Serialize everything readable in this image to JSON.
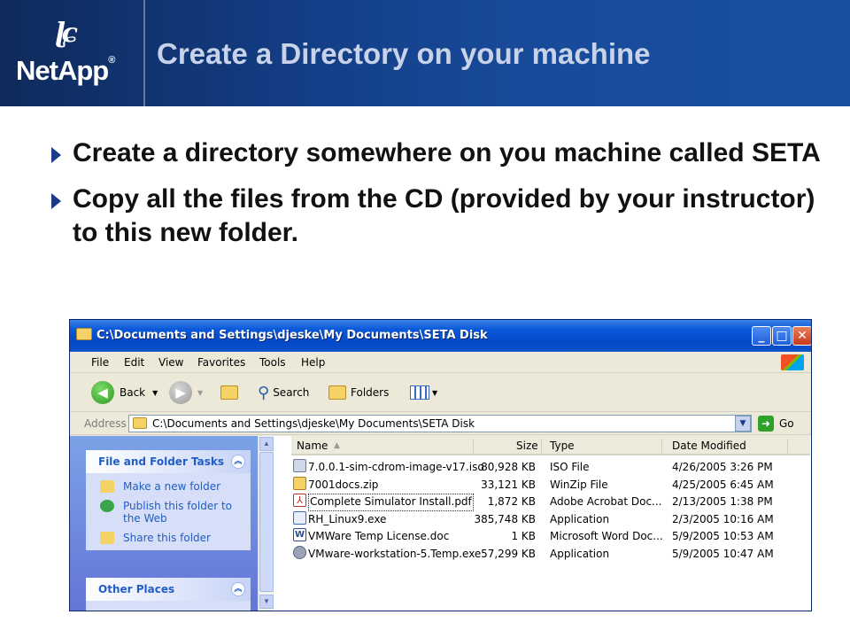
{
  "header": {
    "title": "Create a Directory on your machine",
    "logo_text": "NetApp",
    "logo_reg": "®"
  },
  "bullets": [
    "Create a directory somewhere on you machine called SETA",
    "Copy all the files from the CD (provided by your instructor) to this new folder."
  ],
  "window": {
    "title": "C:\\Documents and Settings\\djeske\\My Documents\\SETA Disk",
    "menu": [
      "File",
      "Edit",
      "View",
      "Favorites",
      "Tools",
      "Help"
    ],
    "toolbar": {
      "back": "Back",
      "search": "Search",
      "folders": "Folders"
    },
    "address": {
      "label": "Address",
      "value": "C:\\Documents and Settings\\djeske\\My Documents\\SETA Disk",
      "go": "Go"
    },
    "tasks": {
      "file_folder_title": "File and Folder Tasks",
      "items": [
        "Make a new folder",
        "Publish this folder to the Web",
        "Share this folder"
      ],
      "other_places_title": "Other Places"
    },
    "columns": {
      "name": "Name",
      "size": "Size",
      "type": "Type",
      "date": "Date Modified"
    },
    "files": [
      {
        "name": "7.0.0.1-sim-cdrom-image-v17.iso",
        "size": "80,928 KB",
        "type": "ISO File",
        "date": "4/26/2005 3:26 PM",
        "icon": "iso-icon"
      },
      {
        "name": "7001docs.zip",
        "size": "33,121 KB",
        "type": "WinZip File",
        "date": "4/25/2005 6:45 AM",
        "icon": "zip-icon"
      },
      {
        "name": "Complete Simulator Install.pdf",
        "size": "1,872 KB",
        "type": "Adobe Acrobat Doc...",
        "date": "2/13/2005 1:38 PM",
        "icon": "pdf-icon"
      },
      {
        "name": "RH_Linux9.exe",
        "size": "385,748 KB",
        "type": "Application",
        "date": "2/3/2005 10:16 AM",
        "icon": "exe-icon"
      },
      {
        "name": "VMWare Temp License.doc",
        "size": "1 KB",
        "type": "Microsoft Word Doc...",
        "date": "5/9/2005 10:53 AM",
        "icon": "doc-icon"
      },
      {
        "name": "VMware-workstation-5.Temp.exe",
        "size": "57,299 KB",
        "type": "Application",
        "date": "5/9/2005 10:47 AM",
        "icon": "vmware-icon"
      }
    ]
  },
  "colors": {
    "header_bg": "#133d85",
    "title_text": "#c8d3ea",
    "xp_title": "#0548c8",
    "task_link": "#215dc6"
  }
}
